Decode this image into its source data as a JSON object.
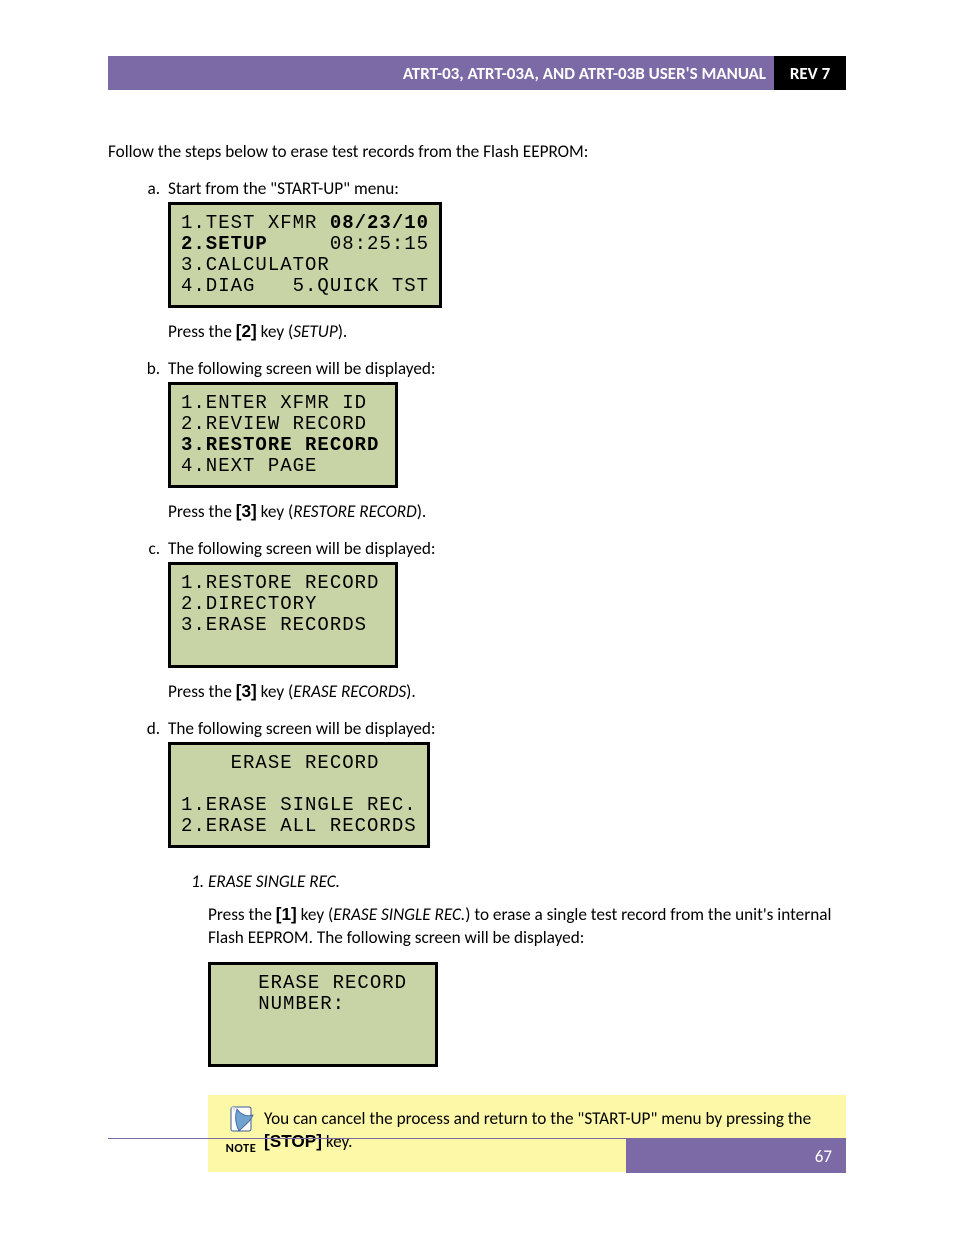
{
  "header": {
    "title": "ATRT-03, ATRT-03A, AND ATRT-03B USER'S MANUAL",
    "rev": "REV 7"
  },
  "intro": "Follow the steps below to erase test records from the Flash EEPROM:",
  "steps": {
    "a": {
      "lead": "Start from the \"START-UP\" menu:",
      "lcd": {
        "l1a": "1.TEST XFMR ",
        "l1b": "08/23/10",
        "l2a": "2.SETUP",
        "l2b": "     08:25:15",
        "l3": "3.CALCULATOR",
        "l4": "4.DIAG   5.QUICK TST"
      },
      "after": {
        "t1": "Press the ",
        "key": "[2]",
        "t2": " key (",
        "ital": "SETUP",
        "t3": ")."
      }
    },
    "b": {
      "lead": "The following screen will be displayed:",
      "lcd": {
        "l1": "1.ENTER XFMR ID",
        "l2": "2.REVIEW RECORD",
        "l3": "3.RESTORE RECORD",
        "l4": "4.NEXT PAGE"
      },
      "after": {
        "t1": "Press the ",
        "key": "[3]",
        "t2": " key (",
        "ital": "RESTORE RECORD",
        "t3": ")."
      }
    },
    "c": {
      "lead": "The following screen will be displayed:",
      "lcd": {
        "l1": "1.RESTORE RECORD",
        "l2": "2.DIRECTORY",
        "l3": "3.ERASE RECORDS",
        "l4": " "
      },
      "after": {
        "t1": "Press the ",
        "key": "[3]",
        "t2": " key (",
        "ital": "ERASE RECORDS",
        "t3": ")."
      }
    },
    "d": {
      "lead": "The following screen will be displayed:",
      "lcd": {
        "l1": "    ERASE RECORD",
        "l2": " ",
        "l3": "1.ERASE SINGLE REC.",
        "l4": "2.ERASE ALL RECORDS"
      },
      "sub1": {
        "title": "ERASE SINGLE REC.",
        "p": {
          "t1": "Press the ",
          "key": "[1]",
          "t2": " key (",
          "ital": "ERASE SINGLE REC.",
          "t3": ") to erase a single test record from the unit's internal Flash EEPROM. The following screen will be displayed:"
        },
        "lcd": {
          "l1": "   ERASE RECORD",
          "l2": "   NUMBER:",
          "l3": " ",
          "l4": " "
        },
        "note": {
          "label": "NOTE",
          "t1": "You can cancel the process and return to the \"START-UP\" menu by pressing the ",
          "key": "[STOP]",
          "t2": " key."
        }
      }
    }
  },
  "footer": {
    "page": "67"
  }
}
